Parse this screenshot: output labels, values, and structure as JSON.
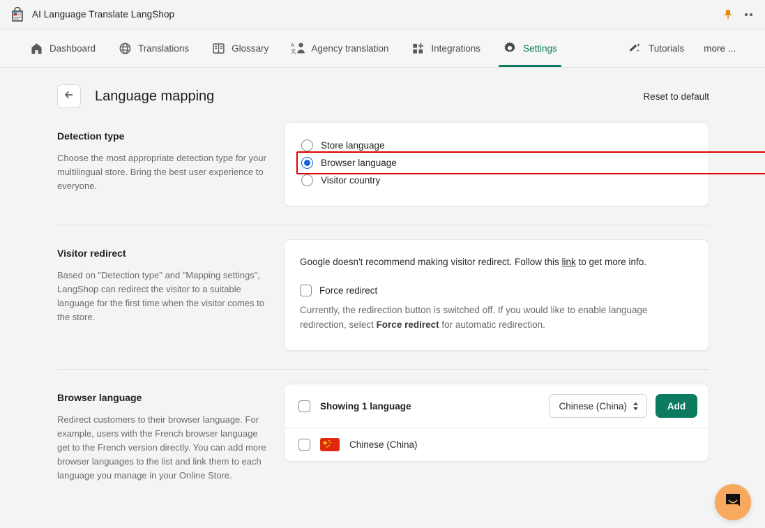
{
  "titlebar": {
    "app_title": "AI Language Translate LangShop",
    "app_icon": "shopping-bag-translate-icon",
    "pin_icon": "pin-icon",
    "overflow_icon": "more-options-icon"
  },
  "nav": {
    "items": [
      {
        "label": "Dashboard",
        "icon": "home-icon",
        "active": false
      },
      {
        "label": "Translations",
        "icon": "globe-icon",
        "active": false
      },
      {
        "label": "Glossary",
        "icon": "book-icon",
        "active": false
      },
      {
        "label": "Agency translation",
        "icon": "translate-person-icon",
        "active": false
      },
      {
        "label": "Integrations",
        "icon": "grid-plus-icon",
        "active": false
      },
      {
        "label": "Settings",
        "icon": "gear-icon",
        "active": true
      },
      {
        "label": "Tutorials",
        "icon": "magic-wand-icon",
        "active": false
      }
    ],
    "more_label": "more ..."
  },
  "page": {
    "back_icon": "arrow-left-icon",
    "title": "Language mapping",
    "reset_label": "Reset to default"
  },
  "detection": {
    "heading": "Detection type",
    "description": "Choose the most appropriate detection type for your multilingual store. Bring the best user experience to everyone.",
    "options": [
      {
        "label": "Store language",
        "selected": false
      },
      {
        "label": "Browser language",
        "selected": true
      },
      {
        "label": "Visitor country",
        "selected": false
      }
    ],
    "highlight_color": "#e00000",
    "radio_accent": "#1565d8"
  },
  "visitor_redirect": {
    "heading": "Visitor redirect",
    "description": "Based on \"Detection type\" and \"Mapping settings\", LangShop can redirect the visitor to a suitable language for the first time when the visitor comes to the store.",
    "notice_before_link": "Google doesn't recommend making visitor redirect. Follow this ",
    "notice_link": "link",
    "notice_after_link": " to get more info.",
    "checkbox_label": "Force redirect",
    "checkbox_checked": false,
    "note_part1": "Currently, the redirection button is switched off. If you would like to enable language redirection, select ",
    "note_bold": "Force redirect",
    "note_part2": " for automatic redirection."
  },
  "browser_language": {
    "heading": "Browser language",
    "description": "Redirect customers to their browser language. For example, users with the French browser language get to the French version directly. You can add more browser languages to the list and link them to each language you manage in your Online Store.",
    "list_header_label": "Showing 1 language",
    "select_value": "Chinese (China)",
    "add_label": "Add",
    "add_color": "#0b7a5e",
    "rows": [
      {
        "flag": "china-flag-icon",
        "name": "Chinese (China)",
        "checked": false
      }
    ]
  },
  "chat": {
    "icon": "intercom-chat-icon",
    "color": "#f9a860"
  }
}
